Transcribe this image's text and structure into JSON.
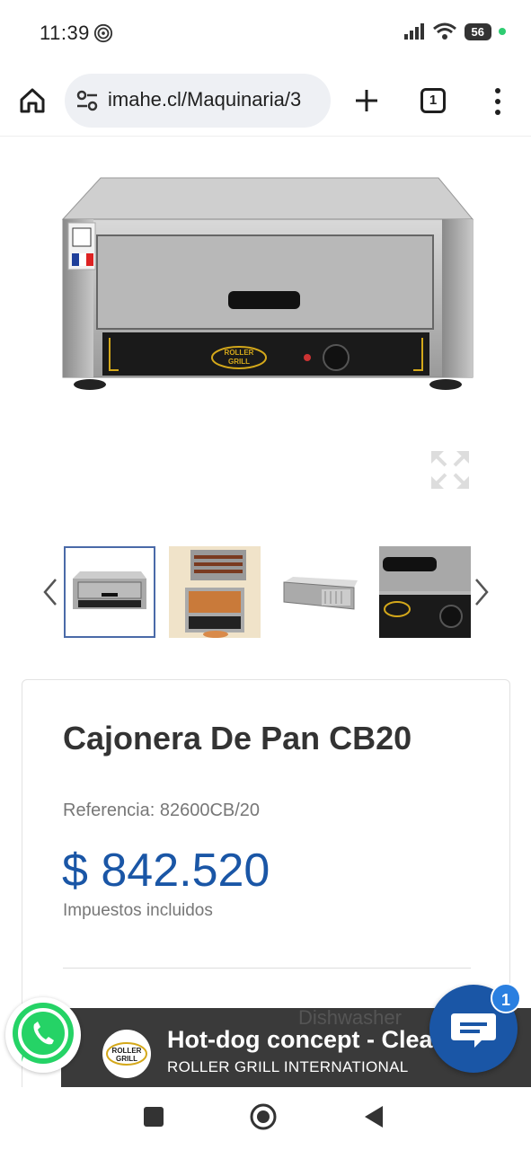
{
  "status_bar": {
    "time": "11:39",
    "battery": "56",
    "icons": [
      "fingerprint-icon",
      "signal-icon",
      "wifi-icon",
      "battery-icon"
    ]
  },
  "browser": {
    "url": "imahe.cl/Maquinaria/3",
    "tab_count": "1",
    "icons": [
      "home-icon",
      "tune-icon",
      "plus-icon",
      "tabs-icon",
      "more-vert-icon"
    ]
  },
  "product": {
    "title": "Cajonera De Pan CB20",
    "reference_label": "Referencia: 82600CB/20",
    "price": "$ 842.520",
    "tax_note": "Impuestos incluidos",
    "brand_logo_text": [
      "ROLLER",
      "GRILL"
    ]
  },
  "gallery": {
    "thumbnail_count": 4,
    "active_index": 0
  },
  "ad": {
    "title": "Hot-dog concept - Clean",
    "subtitle": "ROLLER GRILL INTERNATIONAL",
    "background_text": "Dishwasher"
  },
  "chat": {
    "badge": "1"
  },
  "colors": {
    "price": "#1a56a6",
    "chat_button": "#1a56a6",
    "whatsapp": "#25d366",
    "badge": "#2a7fe0"
  }
}
